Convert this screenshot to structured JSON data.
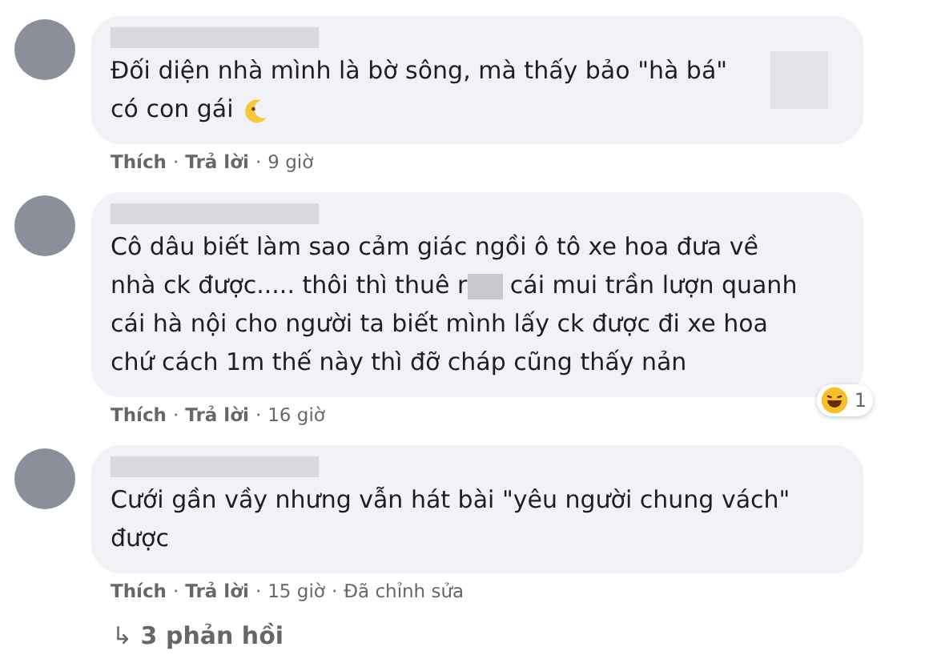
{
  "comments": [
    {
      "segments": [
        {
          "kind": "text",
          "text": "Đối diện nhà mình là bờ sông, mà thấy bảo \"hà bá\"\ncó con gái "
        },
        {
          "kind": "emoji"
        }
      ],
      "attachment": true,
      "actions": [
        {
          "kind": "link",
          "text": "Thích"
        },
        {
          "kind": "sep",
          "text": "·"
        },
        {
          "kind": "link",
          "text": "Trả lời"
        },
        {
          "kind": "sep",
          "text": "·"
        },
        {
          "kind": "time",
          "text": "9 giờ"
        }
      ]
    },
    {
      "segments": [
        {
          "kind": "text",
          "text": "Cô dâu biết làm sao cảm giác ngồi ô tô xe hoa đưa về\nnhà ck được..... thôi thì thuê r"
        },
        {
          "kind": "blur"
        },
        {
          "kind": "text",
          "text": " cái mui trần lượn quanh\ncái hà nội cho người ta biết mình lấy ck được đi xe hoa\nchứ cách 1m thế này thì đỡ cháp cũng thấy nản"
        }
      ],
      "attachment": false,
      "reaction": {
        "count": "1"
      },
      "actions": [
        {
          "kind": "link",
          "text": "Thích"
        },
        {
          "kind": "sep",
          "text": "·"
        },
        {
          "kind": "link",
          "text": "Trả lời"
        },
        {
          "kind": "sep",
          "text": "·"
        },
        {
          "kind": "time",
          "text": "16 giờ"
        }
      ]
    },
    {
      "segments": [
        {
          "kind": "text",
          "text": "Cưới gần vầy nhưng vẫn hát bài \"yêu người chung vách\"\nđược"
        }
      ],
      "attachment": false,
      "actions": [
        {
          "kind": "link",
          "text": "Thích"
        },
        {
          "kind": "sep",
          "text": "·"
        },
        {
          "kind": "link",
          "text": "Trả lời"
        },
        {
          "kind": "sep",
          "text": "·"
        },
        {
          "kind": "time",
          "text": "15 giờ"
        },
        {
          "kind": "sep",
          "text": "·"
        },
        {
          "kind": "note",
          "text": "Đã chỉnh sửa"
        }
      ]
    }
  ],
  "replies_link": {
    "arrow": "↳",
    "label": "3 phản hồi"
  }
}
